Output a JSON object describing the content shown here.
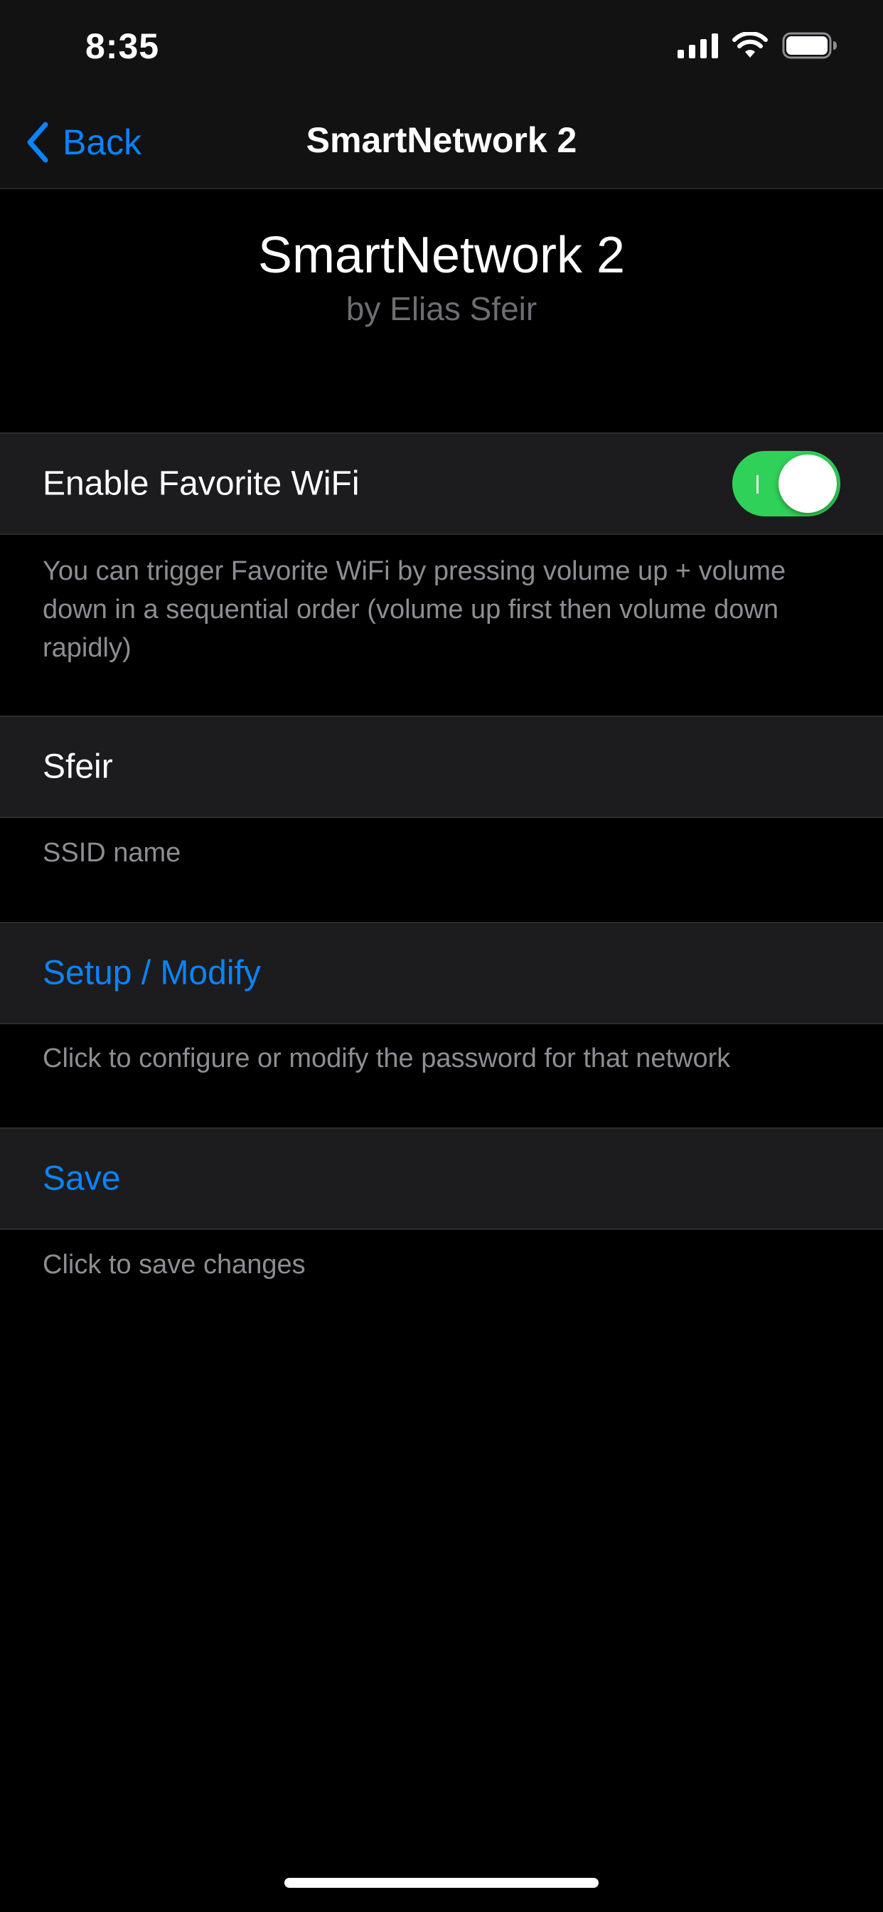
{
  "status_bar": {
    "time": "8:35",
    "icons": [
      "cellular-signal-icon",
      "wifi-icon",
      "battery-icon"
    ]
  },
  "nav": {
    "back_label": "Back",
    "back_icon": "chevron-left-icon",
    "title": "SmartNetwork 2"
  },
  "header": {
    "app_name": "SmartNetwork 2",
    "author": "by Elias Sfeir"
  },
  "sections": {
    "favorite_wifi": {
      "label": "Enable Favorite WiFi",
      "enabled": true,
      "footer": "You can trigger Favorite WiFi by pressing volume up + volume down in a sequential order (volume up first then volume down rapidly)"
    },
    "ssid": {
      "value": "Sfeir",
      "footer": "SSID name"
    },
    "setup": {
      "label": "Setup / Modify",
      "footer": "Click to configure or modify the password for that network"
    },
    "save": {
      "label": "Save",
      "footer": "Click to save changes"
    }
  },
  "colors": {
    "accent": "#0a84ff",
    "toggle_on": "#30d158",
    "cell_background": "#1c1c1e",
    "background": "#000000"
  }
}
